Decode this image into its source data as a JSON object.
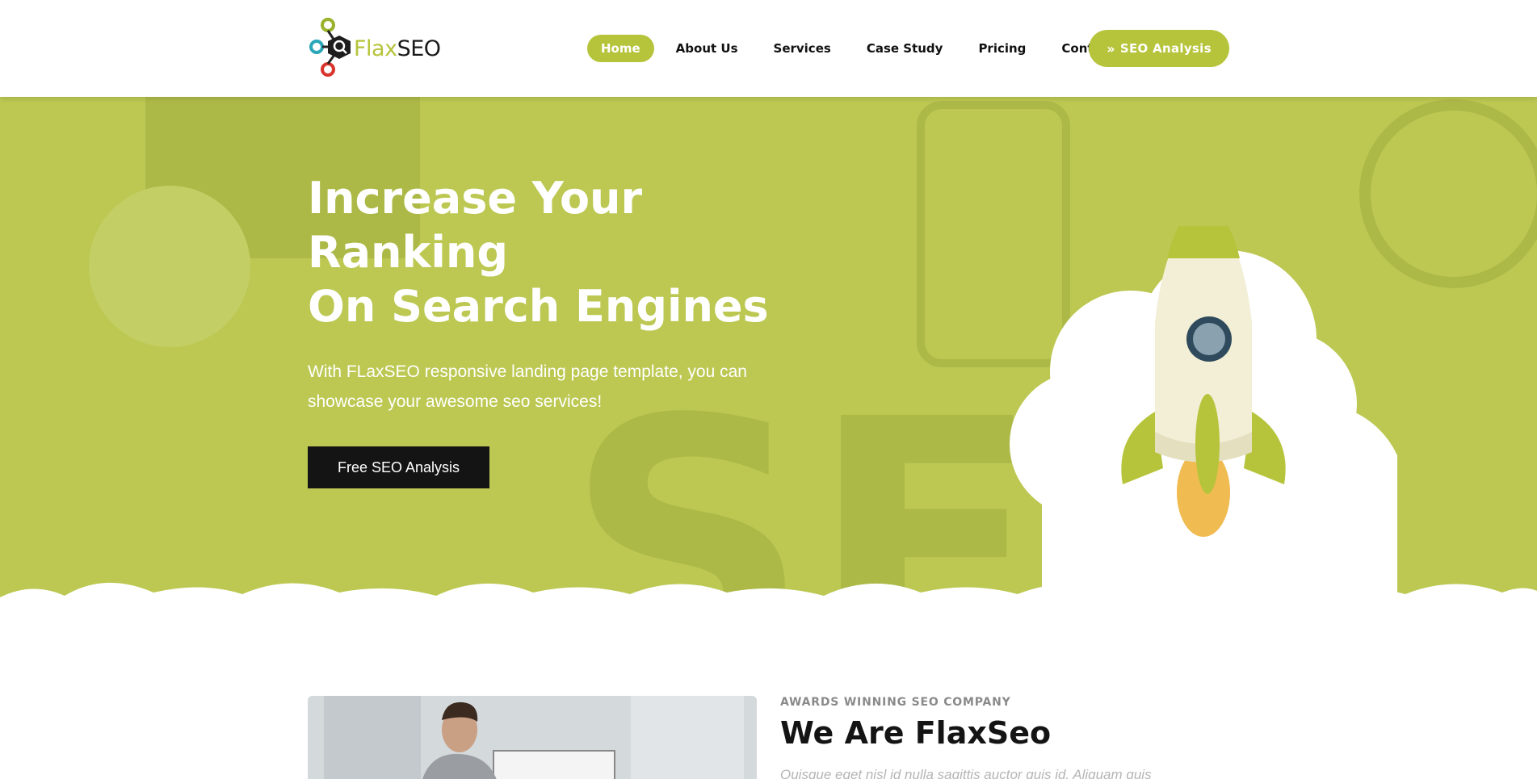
{
  "brand": {
    "name_part1": "Flax",
    "name_part2": "SEO",
    "accent": "#b6c43b",
    "dark": "#141414"
  },
  "nav": {
    "items": [
      {
        "label": "Home",
        "active": true
      },
      {
        "label": "About Us",
        "active": false
      },
      {
        "label": "Services",
        "active": false
      },
      {
        "label": "Case Study",
        "active": false
      },
      {
        "label": "Pricing",
        "active": false
      },
      {
        "label": "Contact",
        "active": false
      }
    ],
    "cta_label": "SEO Analysis",
    "cta_icon": "double-chevron-right-icon"
  },
  "hero": {
    "title_lines": [
      "Increase Your",
      "Ranking",
      "On Search Engines"
    ],
    "subtitle": "With FLaxSEO responsive landing page template, you can showcase your awesome seo services!",
    "button_label": "Free SEO Analysis",
    "background": "#bcc852"
  },
  "about": {
    "eyebrow": "AWARDS WINNING SEO COMPANY",
    "title": "We Are FlaxSeo",
    "text": "Quisque eget nisl id nulla sagittis auctor quis id. Aliquam quis"
  }
}
